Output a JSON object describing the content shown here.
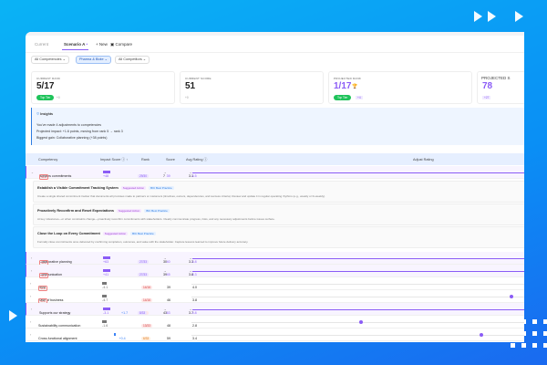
{
  "tabs": {
    "current": "Current",
    "scenario": "Scenario A",
    "new": "+ New",
    "compare": "Compare"
  },
  "filters": [
    "All Competencies",
    "Pharma & Biote",
    "All Competitors"
  ],
  "cards": [
    {
      "label": "CURRENT RANK",
      "value": "5/17",
      "badge": "Top Tier",
      "delta": "+0"
    },
    {
      "label": "CURRENT SCORE",
      "value": "51",
      "delta": "+0"
    },
    {
      "label": "PROJECTED RANK",
      "value": "1/17",
      "badge": "Top Tier",
      "delta": "+4"
    },
    {
      "label": "PROJECTED S",
      "value": "78",
      "delta": "+27"
    }
  ],
  "insights": {
    "title": "Insights",
    "lines": [
      "You've made 4 adjustments to competencies",
      "Projected impact: +1.6 points, moving from rank 5 → rank 3",
      "Biggest gain: Collaborative planning (+38 points)"
    ]
  },
  "table": {
    "headers": [
      "Competency",
      "Impact Score ⓘ ↑",
      "Rank",
      "Score",
      "Avg Rating ⓘ",
      "Adjust Rating"
    ],
    "first": {
      "name": "Bolsters commitments",
      "tag": "New",
      "impact": "+48",
      "rank_from": "14/15",
      "rank_to": "29/30",
      "score_from": "7",
      "score_to": "39",
      "rating_from": "3.1",
      "rating_to": "4.5"
    },
    "actions": [
      {
        "title": "Establish a Visible Commitment Tracking System",
        "desc": "Create a single shared commitment tracker that documents all promises made to partners or customers (timelines, owners, dependencies, and success criteria). Review and update it in regular operating rhythms (e.g., weekly or bi-weekly)."
      },
      {
        "title": "Proactively Reconfirm and Reset Expectations",
        "desc": "At key milestones—or when constraints change—proactively reconfirm commitments with stakeholders. Clearly communicate progress, risks, and any necessary adjustments before issues surface."
      },
      {
        "title": "Close the Loop on Every Commitment",
        "desc": "Formally close commitments once delivered by confirming completion, outcomes, and value with the stakeholder. Capture lessons learned to improve future delivery accuracy."
      }
    ],
    "action_tags": [
      "Suggested Action",
      "BIC Best Practice"
    ],
    "rows": [
      {
        "name": "Collaborative planning",
        "tag": "New",
        "impact": "+63",
        "rank_from": "33/33",
        "rank_to": "27/33",
        "score_from": "30",
        "score_to": "40",
        "rating_from": "3.3",
        "rating_to": "4.8",
        "mod": true
      },
      {
        "name": "Communication",
        "tag": "New",
        "impact": "+41",
        "rank_from": "26/33",
        "rank_to": "27/33",
        "score_from": "39",
        "score_to": "45",
        "rating_from": "3.8",
        "rating_to": "4.3",
        "mod": true
      },
      {
        "name": "Trust",
        "tag": "New",
        "impact": "-4.1",
        "rank_from": "14/16",
        "score_from": "39",
        "rating_from": "4.0",
        "mod": false
      },
      {
        "name": "Ease of business",
        "tag": "New",
        "impact": "-4.7",
        "rank_from": "14/16",
        "score_from": "46",
        "rating_from": "3.8",
        "mod": false,
        "knob": 97
      },
      {
        "name": "Supports our strategy",
        "tag": "",
        "impact": "-3.1",
        "impact2": "+1.7",
        "rank_from": "11/33",
        "rank_to": "8/33",
        "score_from": "43",
        "score_to": "63",
        "rating_from": "3.7",
        "rating_to": "4.8",
        "mod": true
      },
      {
        "name": "Sustainability communication",
        "tag": "",
        "impact": "-1.6",
        "rank_from": "13/33",
        "score_from": "48",
        "rating_from": "2.8",
        "mod": false,
        "knob": 67
      },
      {
        "name": "Cross-functional alignment",
        "tag": "",
        "impact": "",
        "impact2": "+0.4",
        "rank_from": "6/33",
        "score_from": "59",
        "rating_from": "3.4",
        "mod": false,
        "knob": 91
      }
    ]
  }
}
